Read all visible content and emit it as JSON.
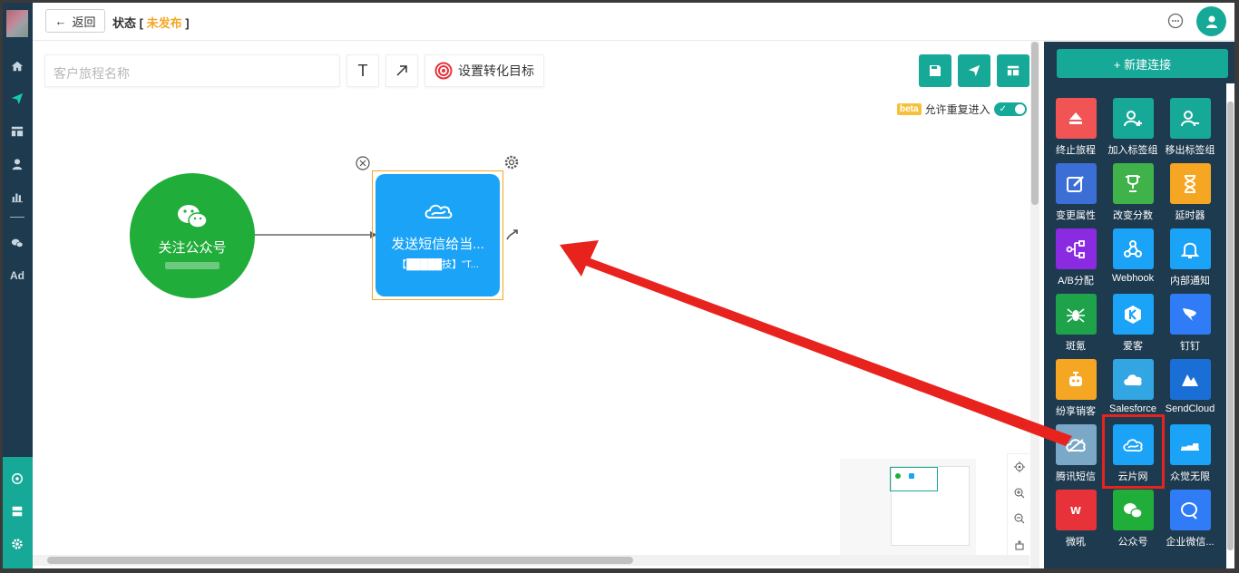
{
  "topbar": {
    "back_label": "返回",
    "status_prefix": "状态 [",
    "status_value": "未发布",
    "status_suffix": "]"
  },
  "canvas": {
    "name_placeholder": "客户旅程名称",
    "goal_label": "设置转化目标",
    "beta_label": "beta",
    "repeat_label": "允许重复进入",
    "start_node_label": "关注公众号",
    "sms_node_title": "发送短信给当...",
    "sms_node_sub": "【█████技】\"T..."
  },
  "rightpanel": {
    "new_connection_label": "+ 新建连接",
    "tiles": [
      {
        "label": "终止旅程",
        "color": "#f05454",
        "icon": "eject-icon"
      },
      {
        "label": "加入标签组",
        "color": "#17a998",
        "icon": "user-plus-icon"
      },
      {
        "label": "移出标签组",
        "color": "#17a998",
        "icon": "user-minus-icon"
      },
      {
        "label": "变更属性",
        "color": "#3b6fd6",
        "icon": "edit-icon"
      },
      {
        "label": "改变分数",
        "color": "#3fb24a",
        "icon": "trophy-icon"
      },
      {
        "label": "延时器",
        "color": "#f5a623",
        "icon": "hourglass-icon"
      },
      {
        "label": "A/B分配",
        "color": "#8a2be2",
        "icon": "split-icon"
      },
      {
        "label": "Webhook",
        "color": "#1aa3f7",
        "icon": "webhook-icon"
      },
      {
        "label": "内部通知",
        "color": "#1aa3f7",
        "icon": "bell-icon"
      },
      {
        "label": "斑氪",
        "color": "#1fa34a",
        "icon": "spider-icon"
      },
      {
        "label": "爱客",
        "color": "#1aa3f7",
        "icon": "k-icon"
      },
      {
        "label": "钉钉",
        "color": "#2f7cf6",
        "icon": "dingtalk-icon"
      },
      {
        "label": "纷享销客",
        "color": "#f5a623",
        "icon": "robot-icon"
      },
      {
        "label": "Salesforce",
        "color": "#32a6e3",
        "icon": "cloud-icon"
      },
      {
        "label": "SendCloud",
        "color": "#1a6fd6",
        "icon": "sendcloud-icon"
      },
      {
        "label": "腾讯短信",
        "color": "#7aa8c6",
        "icon": "tencent-cloud-icon"
      },
      {
        "label": "云片网",
        "color": "#1aa3f7",
        "icon": "yunpian-icon"
      },
      {
        "label": "众觉无限",
        "color": "#1aa3f7",
        "icon": "zhongjue-icon"
      },
      {
        "label": "微吼",
        "color": "#e8323a",
        "icon": "weihou-icon"
      },
      {
        "label": "公众号",
        "color": "#20ad3a",
        "icon": "wechat-icon"
      },
      {
        "label": "企业微信...",
        "color": "#2f7cf6",
        "icon": "wecom-icon"
      }
    ]
  },
  "colors": {
    "accent": "#17a998",
    "nav_bg": "#1e3a4f",
    "status_unpublished": "#f5a623",
    "sms_node": "#1aa3f7",
    "start_node": "#20ad3a",
    "annotation_red": "#e8231e"
  }
}
